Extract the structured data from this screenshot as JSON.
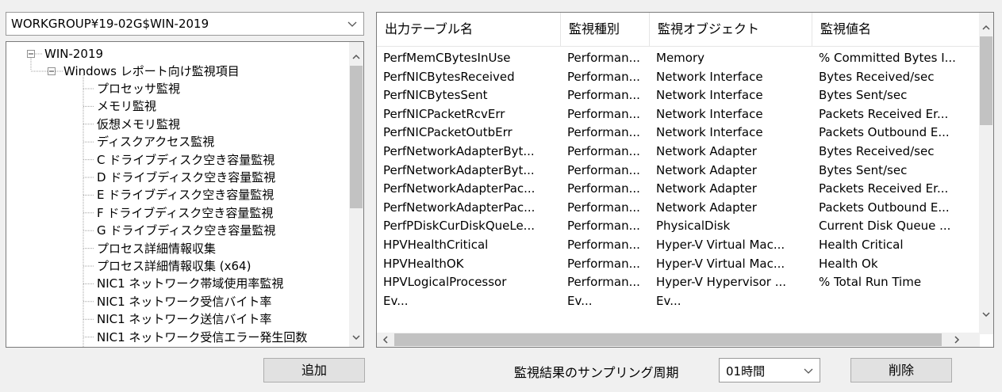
{
  "workgroup_select": {
    "value": "WORKGROUP¥19-02G$WIN-2019"
  },
  "tree": {
    "root": "WIN-2019",
    "group": "Windows レポート向け監視項目",
    "items": [
      "プロセッサ監視",
      "メモリ監視",
      "仮想メモリ監視",
      "ディスクアクセス監視",
      "C ドライブディスク空き容量監視",
      "D ドライブディスク空き容量監視",
      "E ドライブディスク空き容量監視",
      "F ドライブディスク空き容量監視",
      "G ドライブディスク空き容量監視",
      "プロセス詳細情報収集",
      "プロセス詳細情報収集 (x64)",
      "NIC1 ネットワーク帯域使用率監視",
      "NIC1 ネットワーク受信バイト率",
      "NIC1 ネットワーク送信バイト率",
      "NIC1 ネットワーク受信エラー発生回数"
    ]
  },
  "grid": {
    "columns": [
      "出力テーブル名",
      "監視種別",
      "監視オブジェクト",
      "監視値名"
    ],
    "rows": [
      [
        "PerfMemCBytesInUse",
        "Performan...",
        "Memory",
        "% Committed Bytes I..."
      ],
      [
        "PerfNICBytesReceived",
        "Performan...",
        "Network Interface",
        "Bytes Received/sec"
      ],
      [
        "PerfNICBytesSent",
        "Performan...",
        "Network Interface",
        "Bytes Sent/sec"
      ],
      [
        "PerfNICPacketRcvErr",
        "Performan...",
        "Network Interface",
        "Packets Received Er..."
      ],
      [
        "PerfNICPacketOutbErr",
        "Performan...",
        "Network Interface",
        "Packets Outbound E..."
      ],
      [
        "PerfNetworkAdapterByt...",
        "Performan...",
        "Network Adapter",
        "Bytes Received/sec"
      ],
      [
        "PerfNetworkAdapterByt...",
        "Performan...",
        "Network Adapter",
        "Bytes Sent/sec"
      ],
      [
        "PerfNetworkAdapterPac...",
        "Performan...",
        "Network Adapter",
        "Packets Received Er..."
      ],
      [
        "PerfNetworkAdapterPac...",
        "Performan...",
        "Network Adapter",
        "Packets Outbound E..."
      ],
      [
        "PerfPDiskCurDiskQueLe...",
        "Performan...",
        "PhysicalDisk",
        "Current Disk Queue ..."
      ],
      [
        "HPVHealthCritical",
        "Performan...",
        "Hyper-V Virtual Mac...",
        "Health Critical"
      ],
      [
        "HPVHealthOK",
        "Performan...",
        "Hyper-V Virtual Mac...",
        "Health Ok"
      ],
      [
        "HPVLogicalProcessor",
        "Performan...",
        "Hyper-V Hypervisor ...",
        "% Total Run Time"
      ],
      [
        "Ev...",
        "Ev...",
        "Ev...",
        ""
      ]
    ]
  },
  "bottom": {
    "add_label": "追加",
    "sampling_label": "監視結果のサンプリング周期",
    "sampling_value": "01時間",
    "delete_label": "削除"
  },
  "colors": {
    "scroll_thumb": "#c2c2c2",
    "button_face": "#e1e1e1",
    "panel_bg": "#f0f0f0"
  }
}
